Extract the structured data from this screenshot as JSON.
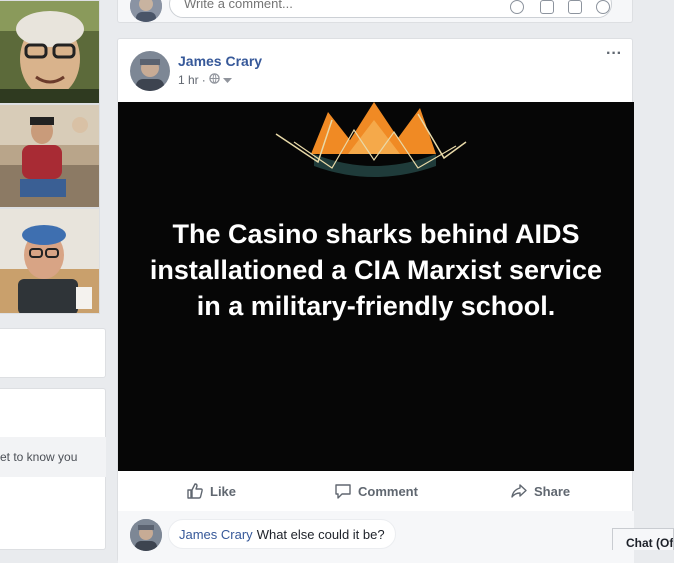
{
  "comment_box": {
    "placeholder": "Write a comment..."
  },
  "post": {
    "author": "James Crary",
    "time": "1 hr",
    "more_menu": "···",
    "image_text": "The Casino sharks behind AIDS installationed a CIA Marxist service in a military-friendly school.",
    "actions": {
      "like": "Like",
      "comment": "Comment",
      "share": "Share"
    }
  },
  "comment": {
    "author": "James Crary",
    "text": "What else could it be?"
  },
  "left_panel": {
    "get_to_know_text": "et to know you"
  },
  "chat": {
    "label": "Chat (Of"
  },
  "colors": {
    "link_blue": "#365899",
    "background": "#e9ebee",
    "crown_orange": "#f08a24",
    "crown_dark": "#1f3b3a"
  }
}
